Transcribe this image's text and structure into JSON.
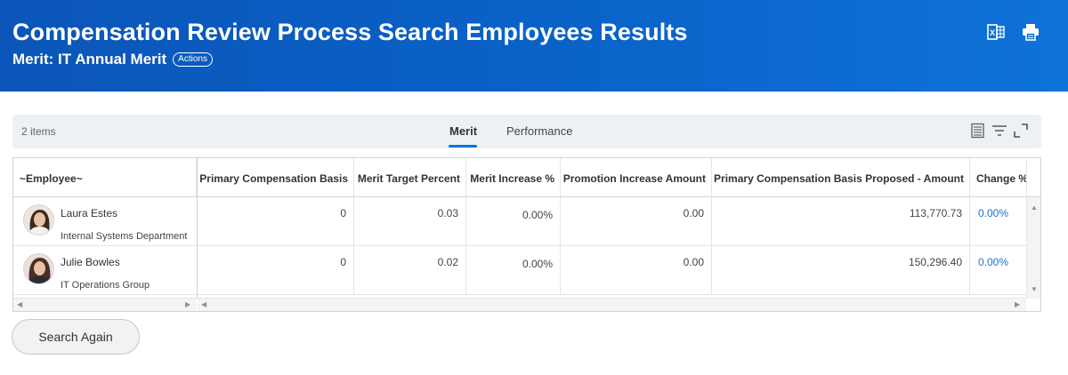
{
  "header": {
    "title": "Compensation Review Process Search Employees Results",
    "subtitle": "Merit: IT Annual Merit",
    "actions_label": "Actions",
    "icons": [
      "excel-export-icon",
      "print-icon"
    ]
  },
  "toolbar": {
    "count": "2 items",
    "tabs": [
      {
        "label": "Merit",
        "active": true
      },
      {
        "label": "Performance",
        "active": false
      }
    ],
    "icons": [
      "table-view-icon",
      "filter-icon",
      "expand-icon"
    ]
  },
  "grid": {
    "columns": [
      "~Employee~",
      "Primary Compensation Basis",
      "Merit Target Percent",
      "Merit Increase %",
      "Promotion Increase Amount",
      "Primary Compensation Basis Proposed - Amount",
      "Change %"
    ],
    "rows": [
      {
        "name": "Laura Estes",
        "dept": "Internal Systems Department",
        "cells": [
          "0",
          "0.03",
          "0.00%",
          "0.00",
          "113,770.73",
          "0.00%"
        ]
      },
      {
        "name": "Julie Bowles",
        "dept": "IT Operations Group",
        "cells": [
          "0",
          "0.02",
          "0.00%",
          "0.00",
          "150,296.40",
          "0.00%"
        ]
      }
    ]
  },
  "footer": {
    "search_again_label": "Search Again"
  },
  "colors": {
    "header_bg": "#0a63c9",
    "accent": "#0875e1",
    "link": "#1a73d0"
  }
}
